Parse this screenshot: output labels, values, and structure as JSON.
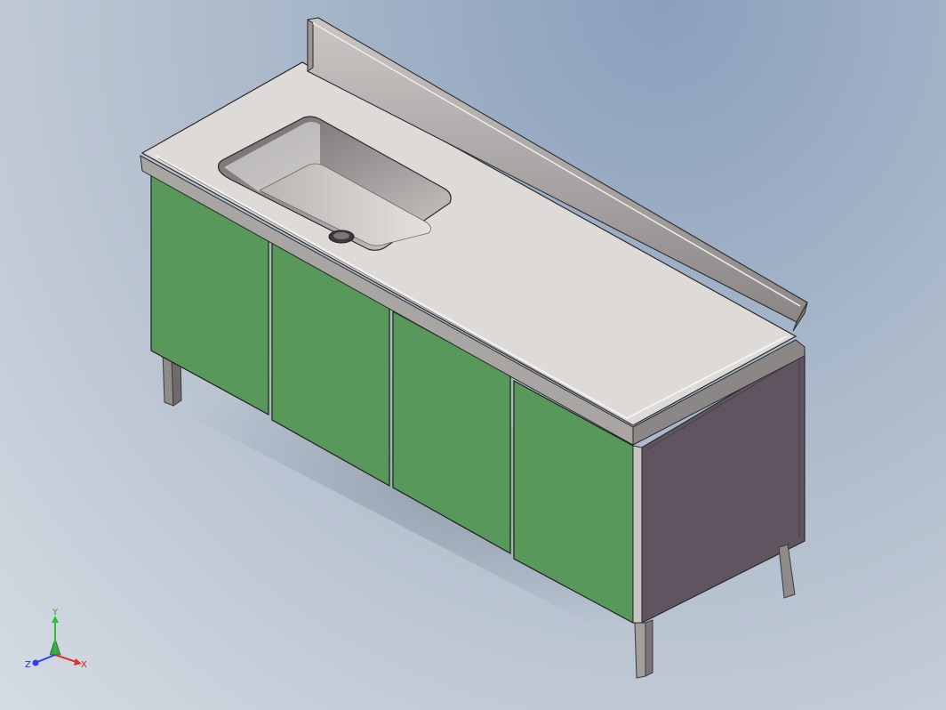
{
  "viewport": {
    "background_top": "#8aa0bd",
    "background_bottom": "#d5dbe3"
  },
  "model": {
    "description_tag": "stainless-sink-cabinet",
    "door_count": 4,
    "door_color": "#58985a",
    "side_panel_color": "#5f5460",
    "steel_color": "#ddd9d6",
    "sink_position": "left"
  },
  "triad": {
    "x_label": "X",
    "y_label": "Y",
    "z_label": "Z",
    "x_color": "#e03030",
    "y_color": "#30c030",
    "z_color": "#3040e0"
  }
}
